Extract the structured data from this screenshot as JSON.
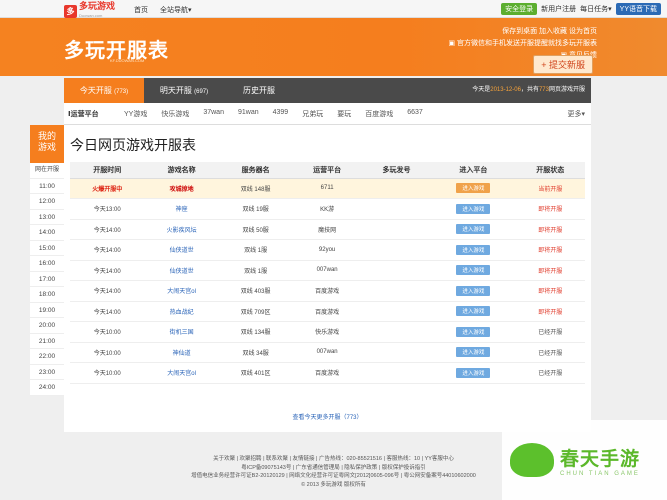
{
  "topbar": {
    "logo_mark": "多",
    "logo_text": "多玩游戏",
    "logo_sub": "Duowan.com",
    "nav": [
      "首页",
      "全站导航▾"
    ],
    "safe_btn": "安全登录",
    "register": "新用户注册",
    "checkin": "每日任务▾",
    "dl_btn": "YY语音下载"
  },
  "banner": {
    "logo": "多玩开服表",
    "logo_url": "KF.DUOWAN.COM",
    "links_row1": "保存到桌面   加入收藏   设为首页",
    "links_row2": "▣ 官方微信和手机发送开服提醒就找多玩开服表",
    "links_row3": "▣ 意见反馈",
    "submit": "+ 提交新服"
  },
  "tabs": [
    {
      "label": "今天开服",
      "count": "(773)"
    },
    {
      "label": "明天开服",
      "count": "(697)"
    },
    {
      "label": "历史开服",
      "count": ""
    }
  ],
  "today_info": {
    "prefix": "今天是",
    "date": "2013-12-06",
    "mid": "，共有",
    "count": "773",
    "suffix": "网页游戏开服"
  },
  "platforms": {
    "label": "Ⅰ运营平台",
    "items": [
      "YY游戏",
      "快乐游戏",
      "37wan",
      "91wan",
      "4399",
      "兄弟玩",
      "要玩",
      "百度游戏",
      "6637"
    ],
    "more": "更多▾"
  },
  "side": {
    "head": "我的\n游戏",
    "items": [
      "网在开服",
      "11:00",
      "12:00",
      "13:00",
      "14:00",
      "15:00",
      "16:00",
      "17:00",
      "18:00",
      "19:00",
      "20:00",
      "21:00",
      "22:00",
      "23:00",
      "24:00"
    ]
  },
  "main": {
    "title": "今日网页游戏开服表",
    "headers": [
      "开服时间",
      "游戏名称",
      "服务器名",
      "运营平台",
      "多玩发号",
      "进入平台",
      "开服状态"
    ],
    "rows": [
      {
        "time": "火爆开服中",
        "game": "攻城掠地",
        "server": "双线 148服",
        "platform": "6711",
        "code": "",
        "enter": "进入游戏",
        "status": "当前开服",
        "hot": true
      },
      {
        "time": "今天13:00",
        "game": "神座",
        "server": "双线 19服",
        "platform": "KK游",
        "code": "",
        "enter": "进入游戏",
        "status": "即将开服",
        "hot": false
      },
      {
        "time": "今天14:00",
        "game": "火影疾风坛",
        "server": "双线 50服",
        "platform": "魔技网",
        "code": "",
        "enter": "进入游戏",
        "status": "即将开服",
        "hot": false
      },
      {
        "time": "今天14:00",
        "game": "仙侠道世",
        "server": "双线 1服",
        "platform": "92you",
        "code": "",
        "enter": "进入游戏",
        "status": "即将开服",
        "hot": false
      },
      {
        "time": "今天14:00",
        "game": "仙侠道世",
        "server": "双线 1服",
        "platform": "007wan",
        "code": "",
        "enter": "进入游戏",
        "status": "即将开服",
        "hot": false
      },
      {
        "time": "今天14:00",
        "game": "大闹天宫ol",
        "server": "双线 403服",
        "platform": "百度游戏",
        "code": "",
        "enter": "进入游戏",
        "status": "即将开服",
        "hot": false
      },
      {
        "time": "今天14:00",
        "game": "热血战纪",
        "server": "双线 709区",
        "platform": "百度游戏",
        "code": "",
        "enter": "进入游戏",
        "status": "即将开服",
        "hot": false
      },
      {
        "time": "今天10:00",
        "game": "街机三国",
        "server": "双线 134服",
        "platform": "快乐游戏",
        "code": "",
        "enter": "进入游戏",
        "status": "已经开服",
        "hot": false
      },
      {
        "time": "今天10:00",
        "game": "神仙道",
        "server": "双线 34服",
        "platform": "007wan",
        "code": "",
        "enter": "进入游戏",
        "status": "已经开服",
        "hot": false
      },
      {
        "time": "今天10:00",
        "game": "大闹天宫ol",
        "server": "双线 401区",
        "platform": "百度游戏",
        "code": "",
        "enter": "进入游戏",
        "status": "已经开服",
        "hot": false
      }
    ],
    "more": "查看今天更多开服（773）"
  },
  "footer": {
    "line1": "关于欢聚 | 欢聚招聘 | 联系欢聚 | 友情链接 | 广告热线：020-85521516 | 客服热线：10 | YY客服中心",
    "line2": "粤ICP备09075143号 | 广东省通信管理局 | 隐私保护政策 | 版权保护投诉指引",
    "line3": "增值电信业务经营许可证B2-20120129 | 网络文化经营许可证粤网文[2012]0605-096号 | 粤公网安备案号44010602000",
    "line4": "© 2013 多玩游戏 版权所有"
  },
  "watermark": {
    "cn": "春天手游",
    "en": "CHUN TIAN GAME"
  }
}
